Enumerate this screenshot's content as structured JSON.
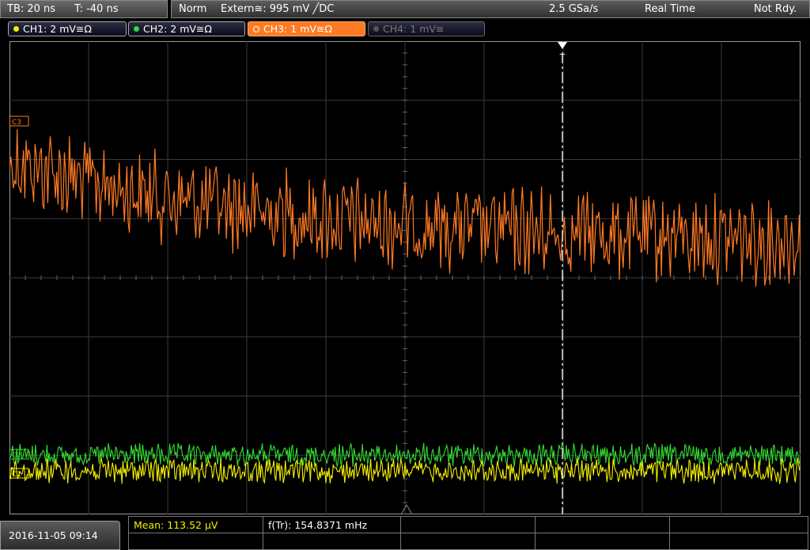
{
  "header": {
    "timebase": "TB: 20 ns",
    "trigger_time": "T: -40 ns",
    "mode": "Norm",
    "trigger": "Extern≅: 995 mV ╱DC",
    "sample_rate": "2.5 GSa/s",
    "acq_mode": "Real Time",
    "status": "Not Rdy."
  },
  "channels": [
    {
      "label": "CH1: 2 mV≅Ω",
      "color": "#f4f000",
      "state": "on"
    },
    {
      "label": "CH2: 2 mV≅Ω",
      "color": "#33dd33",
      "state": "on"
    },
    {
      "label": "CH3: 1 mV≅Ω",
      "color": "#ff7a22",
      "state": "selected"
    },
    {
      "label": "CH4: 1 mV≅",
      "color": "#666666",
      "state": "off"
    }
  ],
  "markers": {
    "ch3": "C3",
    "ch2": "C2",
    "ch1": "C1",
    "trigger": "T"
  },
  "measurements": {
    "mean": "Mean: 113.52 µV",
    "freq": "f(Tr): 154.8371 mHz"
  },
  "datetime": "2016-11-05 09:14",
  "colors": {
    "ch1": "#f4f000",
    "ch2": "#33dd33",
    "ch3": "#ff7a22",
    "grid": "#3a3a3a"
  }
}
